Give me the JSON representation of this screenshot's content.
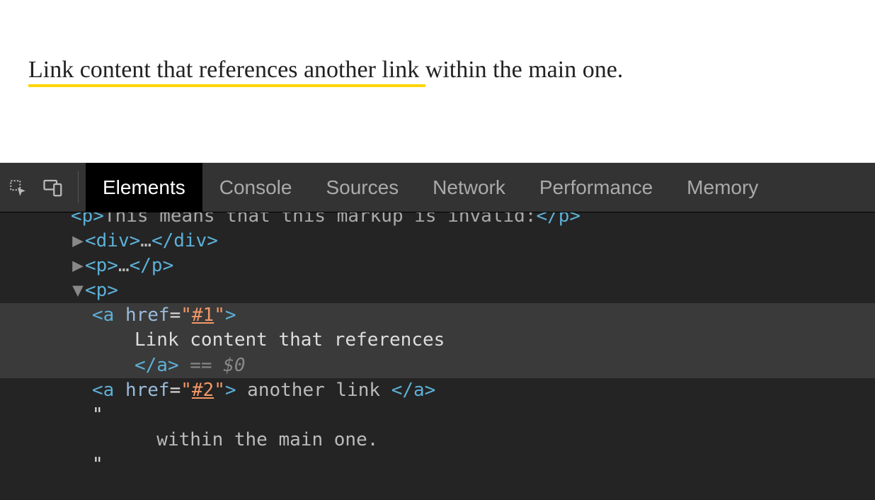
{
  "page": {
    "link1_text": "Link content that references ",
    "link2_text": "another link ",
    "plain_text": "within the main one."
  },
  "devtools": {
    "tabs": {
      "elements": "Elements",
      "console": "Console",
      "sources": "Sources",
      "network": "Network",
      "performance": "Performance",
      "memory": "Memory"
    },
    "dom": {
      "line_invalid_open": "<p>",
      "line_invalid_text": "This means that this markup is invalid:",
      "line_invalid_close": "</p>",
      "div_open": "<div>",
      "div_ell": "…",
      "div_close": "</div>",
      "p_open": "<p>",
      "p_ell": "…",
      "p_close": "</p>",
      "p2_open": "<p>",
      "a1_open_tag": "<a ",
      "href_name": "href",
      "eq": "=",
      "q": "\"",
      "href1_val": "#1",
      "close_angle": ">",
      "a1_text_line": "Link content that references",
      "a1_close": "</a>",
      "selmark": " == ",
      "dollar": "$0",
      "a2_open_tag": "<a ",
      "href2_val": "#2",
      "a2_text": " another link ",
      "a2_close": "</a>",
      "quote_only": "\"",
      "text_within": "  within the main one."
    }
  }
}
